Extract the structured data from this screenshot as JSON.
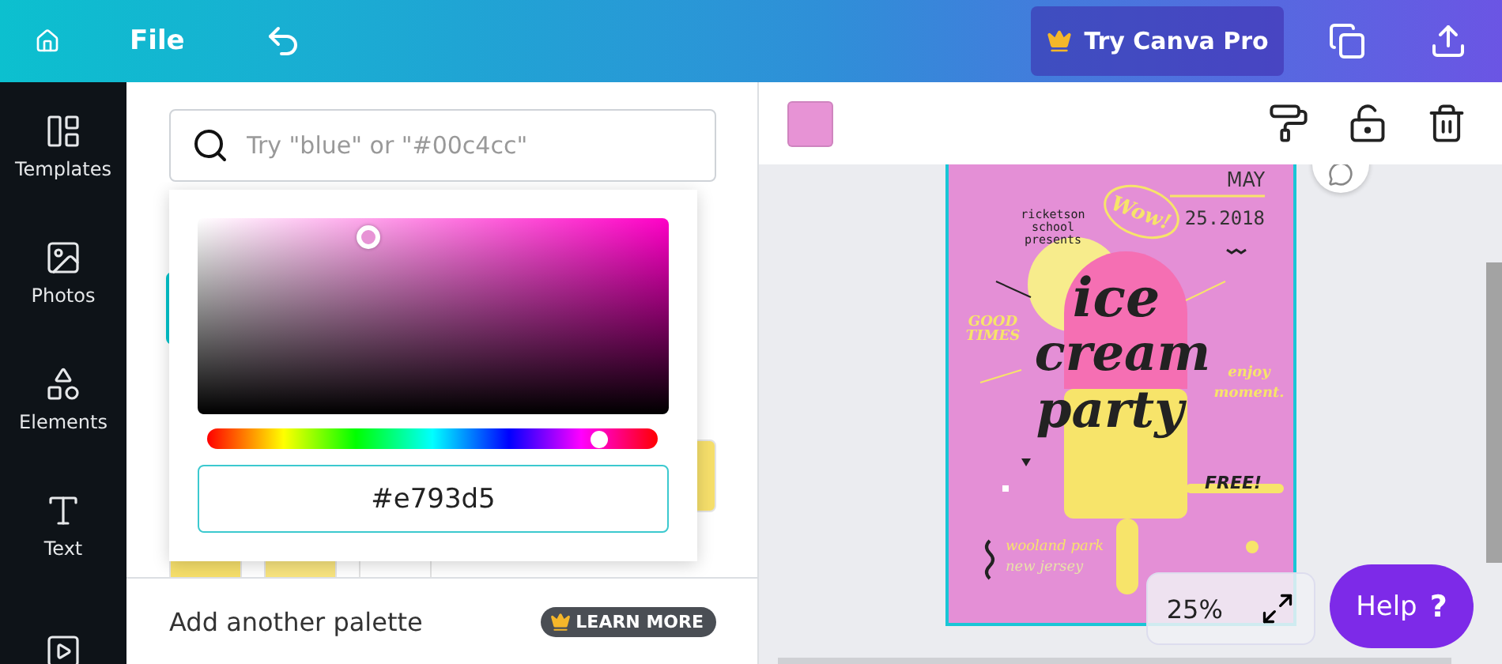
{
  "topbar": {
    "file": "File",
    "pro_button": "Try Canva Pro"
  },
  "sidebar": {
    "items": [
      {
        "kind": "templates",
        "label": "Templates"
      },
      {
        "kind": "photos",
        "label": "Photos"
      },
      {
        "kind": "elements",
        "label": "Elements"
      },
      {
        "kind": "text",
        "label": "Text"
      },
      {
        "kind": "video"
      }
    ]
  },
  "color_panel": {
    "search": {
      "placeholder": "Try \"blue\" or \"#00c4cc\""
    },
    "swatches": [
      {
        "color": "#00c4cc"
      },
      {
        "color": "#f6df6b"
      },
      {
        "color": "#f6df6b"
      },
      {
        "color": "#f8e47e"
      },
      {
        "color": "#ffffff"
      }
    ],
    "picker": {
      "hex": "#e793d5",
      "level": 0.87
    },
    "footer": {
      "label": "Add another palette",
      "badge": "LEARN MORE"
    }
  },
  "canvas": {
    "zoom": "25%",
    "help": {
      "label": "Help",
      "glyph": "?"
    },
    "poster": {
      "month": "MAY",
      "bubble": "Wow!",
      "presenter": [
        "ricketson",
        "school",
        "presents"
      ],
      "date": "25.2018",
      "title": [
        "ice",
        "cream",
        "party"
      ],
      "left_tag": [
        "GOOD",
        "TIMES"
      ],
      "right_tag": [
        "enjoy",
        "moment."
      ],
      "badge": "FREE!",
      "place": [
        "wooland park",
        "new jersey"
      ]
    }
  }
}
